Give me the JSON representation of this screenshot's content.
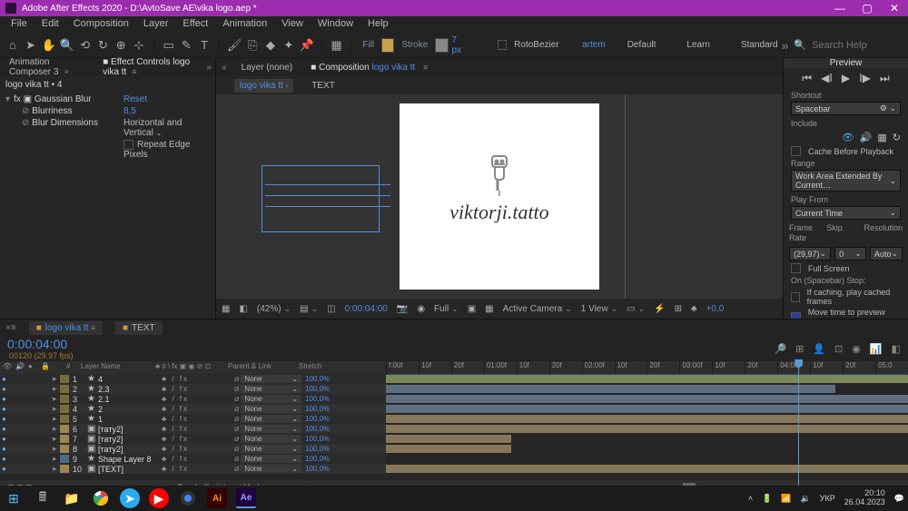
{
  "titlebar": {
    "text": "Adobe After Effects 2020 - D:\\AvtoSave AE\\vika logo.aep *"
  },
  "menus": [
    "File",
    "Edit",
    "Composition",
    "Layer",
    "Effect",
    "Animation",
    "View",
    "Window",
    "Help"
  ],
  "toolbar_fill": "Fill",
  "toolbar_stroke": "Stroke",
  "toolbar_stroke_px": "7 px",
  "toolbar_rotobezier": "RotoBezier",
  "toolbar_user": "artem",
  "toolbar_workspace": "Default",
  "toolbar_learn": "Learn",
  "toolbar_standard": "Standard",
  "search_placeholder": "Search Help",
  "left_panels": {
    "tab1": "Animation Composer 3",
    "tab2": "Effect Controls logo vika tt",
    "title": "logo vika tt • 4",
    "effect_name": "Gaussian Blur",
    "reset": "Reset",
    "blurriness_label": "Blurriness",
    "blurriness_val": "8,5",
    "blurdim_label": "Blur Dimensions",
    "blurdim_val": "Horizontal and Vertical",
    "repeat_label": "Repeat Edge Pixels"
  },
  "center": {
    "tab_layer": "Layer (none)",
    "tab_comp_prefix": "Composition",
    "tab_comp_name": "logo vika tt",
    "subtab1": "logo vika tt",
    "subtab2": "TEXT",
    "logo_text": "viktorji.tatto",
    "footer_zoom": "(42%)",
    "footer_time": "0:00:04:00",
    "footer_res": "Full",
    "footer_camera": "Active Camera",
    "footer_view": "1 View",
    "footer_exp": "+0,0"
  },
  "preview": {
    "title": "Preview",
    "shortcut": "Shortcut",
    "shortcut_val": "Spacebar",
    "include": "Include",
    "cache": "Cache Before Playback",
    "range": "Range",
    "range_val": "Work Area Extended By Current…",
    "playfrom": "Play From",
    "playfrom_val": "Current Time",
    "framerate": "Frame Rate",
    "skip": "Skip",
    "resolution": "Resolution",
    "fps": "(29,97)",
    "skip_val": "0",
    "res_val": "Auto",
    "fullscreen": "Full Screen",
    "onstop": "On (Spacebar) Stop:",
    "ifcaching": "If caching, play cached frames",
    "movetime": "Move time to preview time"
  },
  "timeline": {
    "tab1": "logo vika tt",
    "tab2": "TEXT",
    "timecode": "0:00:04:00",
    "framecode": "00120 (29.97 fps)",
    "col_sourcename": "Layer Name",
    "col_parent": "Parent & Link",
    "col_stretch": "Stretch",
    "ruler": [
      "f:00f",
      "10f",
      "20f",
      "01:00f",
      "10f",
      "20f",
      "02:00f",
      "10f",
      "20f",
      "03:00f",
      "10f",
      "20f",
      "04:00f",
      "10f",
      "20f",
      "05:0"
    ],
    "cti_pct": 79,
    "layers": [
      {
        "n": 1,
        "icon": "★",
        "name": "4",
        "color": "#7a6c3a",
        "bar": [
          0,
          100
        ],
        "barcolor": "#7c8a5a",
        "parent": "None",
        "stretch": "100,0%"
      },
      {
        "n": 2,
        "icon": "★",
        "name": "2.3",
        "color": "#7a6c3a",
        "bar": [
          0,
          86
        ],
        "barcolor": "#5f6f7f",
        "parent": "None",
        "stretch": "100,0%",
        "alt": true
      },
      {
        "n": 3,
        "icon": "★",
        "name": "2.1",
        "color": "#7a6c3a",
        "bar": [
          0,
          100
        ],
        "barcolor": "#5f6f7f",
        "parent": "None",
        "stretch": "100,0%"
      },
      {
        "n": 4,
        "icon": "★",
        "name": "2",
        "color": "#7a6c3a",
        "bar": [
          0,
          100
        ],
        "barcolor": "#5f6f7f",
        "parent": "None",
        "stretch": "100,0%",
        "alt": true
      },
      {
        "n": 5,
        "icon": "★",
        "name": "1",
        "color": "#7a6c3a",
        "bar": [
          0,
          100
        ],
        "barcolor": "#87775a",
        "parent": "None",
        "stretch": "100,0%"
      },
      {
        "n": 6,
        "icon": "▣",
        "name": "[тату2]",
        "color": "#9c8650",
        "bar": [
          0,
          100
        ],
        "barcolor": "#87775a",
        "parent": "None",
        "stretch": "100,0%",
        "alt": true
      },
      {
        "n": 7,
        "icon": "▣",
        "name": "[тату2]",
        "color": "#9c8650",
        "bar": [
          0,
          24
        ],
        "barcolor": "#87775a",
        "parent": "None",
        "stretch": "100,0%"
      },
      {
        "n": 8,
        "icon": "▣",
        "name": "[тату2]",
        "color": "#9c8650",
        "bar": [
          0,
          24
        ],
        "barcolor": "#87775a",
        "parent": "None",
        "stretch": "100,0%",
        "alt": true
      },
      {
        "n": 9,
        "icon": "★",
        "name": "Shape Layer 8",
        "color": "#506a8c",
        "bar": null,
        "parent": "None",
        "stretch": "100,0%"
      },
      {
        "n": 10,
        "icon": "▣",
        "name": "[TEXT]",
        "color": "#9c8650",
        "bar": [
          0,
          100
        ],
        "barcolor": "#87775a",
        "parent": "None",
        "stretch": "100,0%",
        "alt": true
      }
    ],
    "footer": "Toggle Switches / Modes"
  },
  "taskbar": {
    "time": "20:10",
    "date": "26.04.2023",
    "lang": "УКР"
  }
}
